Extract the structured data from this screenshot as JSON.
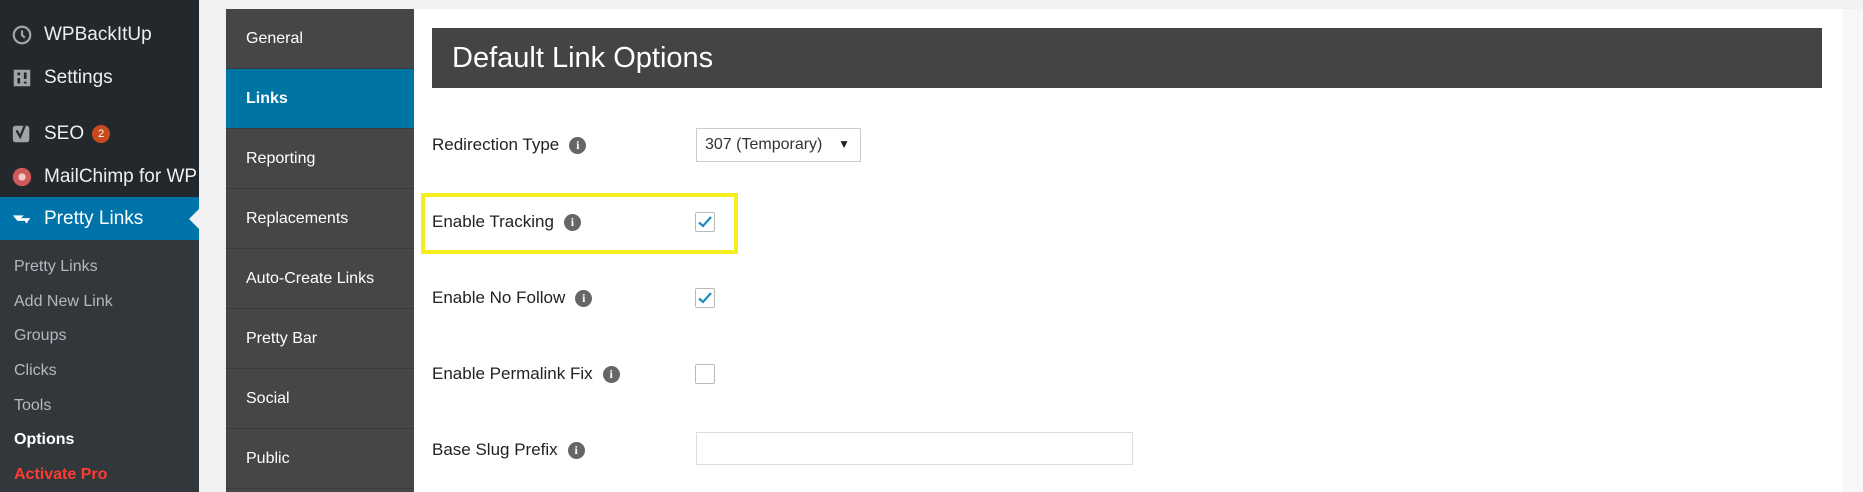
{
  "wp_menu": {
    "items": [
      {
        "label": "WPBackItUp",
        "icon": "clock-icon"
      },
      {
        "label": "Settings",
        "icon": "settings-icon"
      },
      {
        "label": "SEO",
        "icon": "yoast-icon",
        "badge": "2"
      },
      {
        "label": "MailChimp for WP",
        "icon": "mailchimp-icon"
      },
      {
        "label": "Pretty Links",
        "icon": "pretty-links-icon"
      }
    ],
    "submenu": [
      "Pretty Links",
      "Add New Link",
      "Groups",
      "Clicks",
      "Tools",
      "Options",
      "Activate Pro"
    ]
  },
  "settings_nav": {
    "tabs": [
      "General",
      "Links",
      "Reporting",
      "Replacements",
      "Auto-Create Links",
      "Pretty Bar",
      "Social",
      "Public"
    ]
  },
  "main": {
    "heading": "Default Link Options",
    "redirection_type": {
      "label": "Redirection Type",
      "value": "307 (Temporary)"
    },
    "enable_tracking": {
      "label": "Enable Tracking",
      "checked": true
    },
    "enable_no_follow": {
      "label": "Enable No Follow",
      "checked": true
    },
    "enable_permalink_fix": {
      "label": "Enable Permalink Fix",
      "checked": false
    },
    "base_slug_prefix": {
      "label": "Base Slug Prefix",
      "value": ""
    }
  },
  "colors": {
    "sidebar_bg": "#23282d",
    "accent": "#0073aa",
    "highlight": "#f5ee1e",
    "badge": "#ca4a1f",
    "activate_pro": "#ff3b30"
  }
}
